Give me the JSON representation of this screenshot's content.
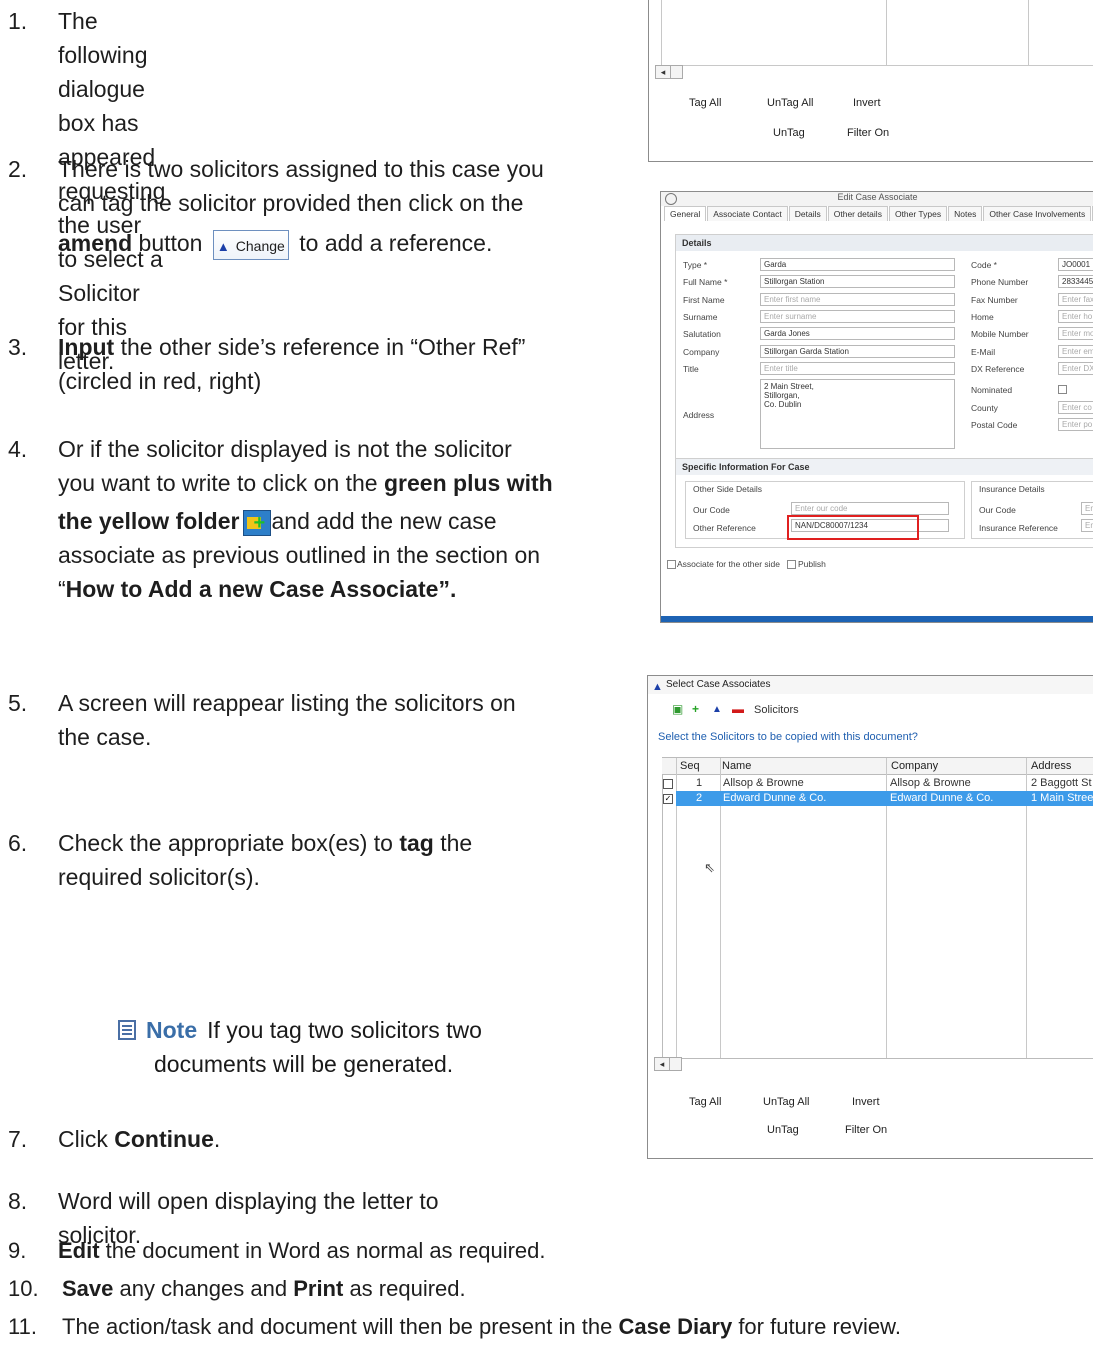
{
  "steps": [
    {
      "num": "1.",
      "lines": [
        "The following dialogue box has appeared",
        "requesting the user to select a Solicitor for this",
        "letter."
      ]
    },
    {
      "num": "2.",
      "line1": "There is two solicitors assigned to this case you",
      "line2": "can tag the solicitor provided then click on the",
      "bold": "amend",
      "mid": " button",
      "button_label": "Change",
      "end": " to add a reference."
    },
    {
      "num": "3.",
      "bold": "Input",
      "rest": " the other side’s reference in “Other Ref”",
      "line2": "(circled in red, right)"
    },
    {
      "num": "4.",
      "line1": "Or if the solicitor displayed is not the solicitor",
      "line2a": "you want to write to click on the ",
      "line2b": "green plus with",
      "line3a": "the yellow folder",
      "line3b": "and add the new case",
      "line4": "associate as previous outlined in the section on",
      "line5a": "“",
      "line5b": "How to Add a new Case Associate”."
    },
    {
      "num": "5.",
      "lines": [
        "A screen will reappear listing the solicitors on",
        "the case."
      ]
    },
    {
      "num": "6.",
      "a": "Check the appropriate box(es) to ",
      "bold": "tag",
      "b": " the",
      "line2": "required solicitor(s)."
    },
    {
      "num": "7.",
      "a": "Click ",
      "bold": "Continue",
      "b": "."
    },
    {
      "num": "8.",
      "lines": [
        "Word will open displaying the letter to",
        "solicitor."
      ]
    },
    {
      "num": "9.",
      "bold": "Edit",
      "rest": " the document in Word as normal as required."
    },
    {
      "num": "10.",
      "bold": "Save",
      "mid": " any changes and ",
      "bold2": "Print",
      "rest": " as required."
    },
    {
      "num": "11.",
      "a": "The action/task and document will then be present in the ",
      "bold": "Case Diary",
      "b": " for future review."
    }
  ],
  "note": {
    "label": "Note",
    "line1": "If you tag two solicitors two",
    "line2": "documents will be generated."
  },
  "shot1": {
    "tag_all": "Tag All",
    "untag_all": "UnTag All",
    "invert": "Invert",
    "untag": "UnTag",
    "filter_on": "Filter On"
  },
  "shot2": {
    "title": "Edit Case Associate",
    "tabs": [
      "General",
      "Associate Contact",
      "Details",
      "Other details",
      "Other Types",
      "Notes",
      "Other Case Involvements",
      "Ba"
    ],
    "details_head": "Details",
    "left_fields": [
      {
        "label": "Type *",
        "value": "Garda"
      },
      {
        "label": "Full Name *",
        "value": "Stillorgan Station"
      },
      {
        "label": "First Name",
        "value": "Enter first name",
        "ph": true
      },
      {
        "label": "Surname",
        "value": "Enter surname",
        "ph": true
      },
      {
        "label": "Salutation",
        "value": "Garda Jones"
      },
      {
        "label": "Company",
        "value": "Stillorgan Garda Station"
      },
      {
        "label": "Title",
        "value": "Enter title",
        "ph": true
      }
    ],
    "address_label": "Address",
    "address_lines": [
      "2 Main Street,",
      "Stillorgan,",
      "Co. Dublin"
    ],
    "right_fields": [
      {
        "label": "Code *",
        "value": "JO0001"
      },
      {
        "label": "Phone Number",
        "value": "2833445"
      },
      {
        "label": "Fax Number",
        "value": "Enter fax",
        "ph": true
      },
      {
        "label": "Home",
        "value": "Enter ho",
        "ph": true
      },
      {
        "label": "Mobile Number",
        "value": "Enter mo",
        "ph": true
      },
      {
        "label": "E-Mail",
        "value": "Enter em",
        "ph": true
      },
      {
        "label": "DX Reference",
        "value": "Enter DX",
        "ph": true
      }
    ],
    "nominated": "Nominated",
    "county": "County",
    "county_ph": "Enter co",
    "postal": "Postal Code",
    "postal_ph": "Enter po",
    "specific_head": "Specific Information For Case",
    "other_side": "Other Side Details",
    "our_code": "Our Code",
    "our_code_ph": "Enter our code",
    "other_ref": "Other Reference",
    "other_ref_val": "NAN/DC80007/1234",
    "insurance": "Insurance Details",
    "ins_our_code": "Our Code",
    "ins_ref": "Insurance Reference",
    "ins_ph": "En",
    "assoc_other": "Associate for the other side",
    "publish": "Publish"
  },
  "shot3": {
    "title": "Select Case Associates",
    "toolbar_label": "Solicitors",
    "prompt": "Select the Solicitors to be copied with this document?",
    "columns": [
      "Seq",
      "Name",
      "Company",
      "Address"
    ],
    "rows": [
      {
        "seq": "1",
        "name": "Allsop & Browne",
        "company": "Allsop & Browne",
        "address": "2 Baggott St",
        "checked": false
      },
      {
        "seq": "2",
        "name": "Edward Dunne & Co.",
        "company": "Edward Dunne & Co.",
        "address": "1 Main Stree",
        "checked": true
      }
    ],
    "tag_all": "Tag All",
    "untag_all": "UnTag All",
    "invert": "Invert",
    "untag": "UnTag",
    "filter_on": "Filter On"
  },
  "colors": {
    "accent": "#1d63b4",
    "selection": "#3d9be9",
    "highlight_ring": "#e02020"
  }
}
